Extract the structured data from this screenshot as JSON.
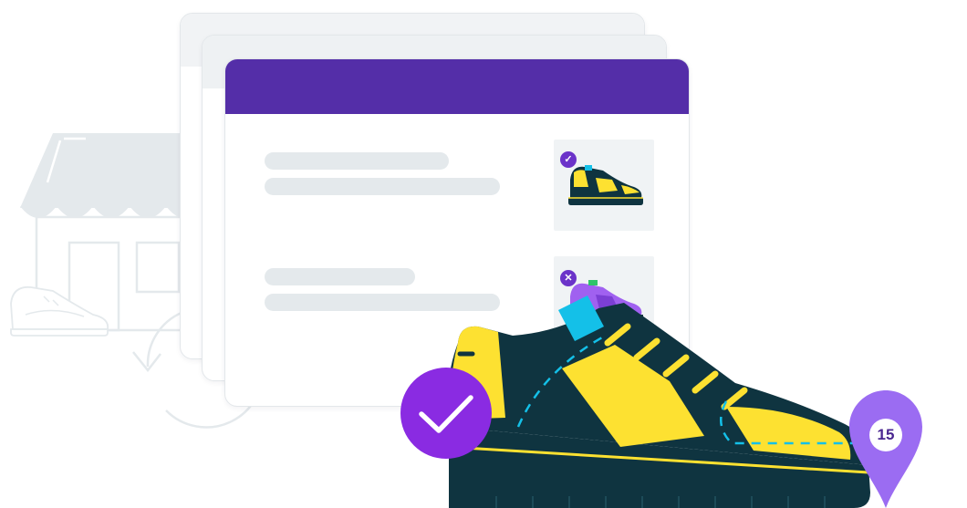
{
  "illustration": {
    "background_color": "#ffffff",
    "header_color": "#542ea8",
    "accent_purple": "#8a2be2",
    "pin_purple": "#9b6cf2",
    "shoe_dark": "#0f3440",
    "shoe_yellow": "#fde131",
    "shoe_blue": "#14c0e8",
    "list_items": [
      {
        "status": "approved",
        "status_icon": "check-icon",
        "thumbnail": "yellow-sneaker-icon"
      },
      {
        "status": "rejected",
        "status_icon": "x-icon",
        "thumbnail": "purple-sneaker-icon"
      }
    ],
    "check_badge_icon": "check-icon",
    "location_pin": {
      "icon": "map-pin-icon",
      "number": "15"
    },
    "decorations": [
      "storefront-icon",
      "white-sneaker-icon",
      "refresh-arrows-icon"
    ]
  }
}
